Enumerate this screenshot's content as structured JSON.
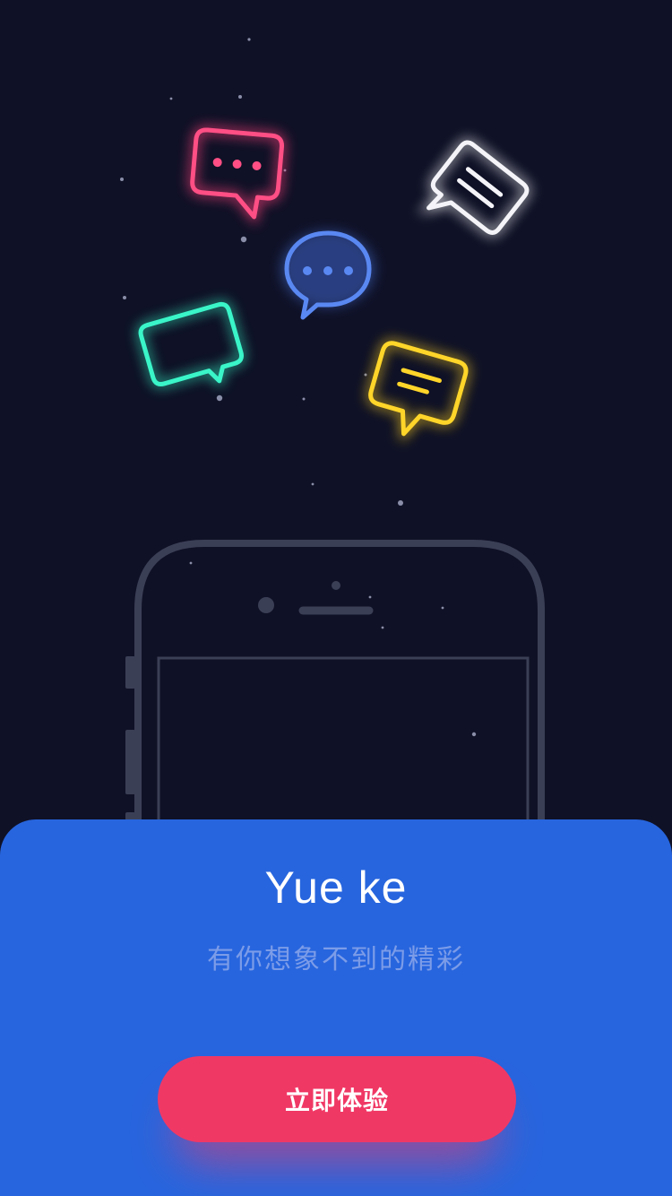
{
  "app": {
    "title": "Yue ke",
    "tagline": "有你想象不到的精彩",
    "cta_label": "立即体验"
  },
  "illustration": {
    "icons": [
      "pink-chat-bubble-icon",
      "white-chat-bubble-icon",
      "blue-chat-bubble-icon",
      "green-chat-bubble-icon",
      "yellow-chat-bubble-icon",
      "phone-outline-icon"
    ]
  },
  "colors": {
    "background": "#0f1126",
    "panel": "#2765de",
    "cta": "#f03865",
    "bubble_pink": "#ff3f7a",
    "bubble_blue": "#4f7ff0",
    "bubble_green": "#32f0c0",
    "bubble_yellow": "#ffd21f",
    "bubble_white": "#ffffff",
    "phone_outline": "#3b3f56"
  }
}
